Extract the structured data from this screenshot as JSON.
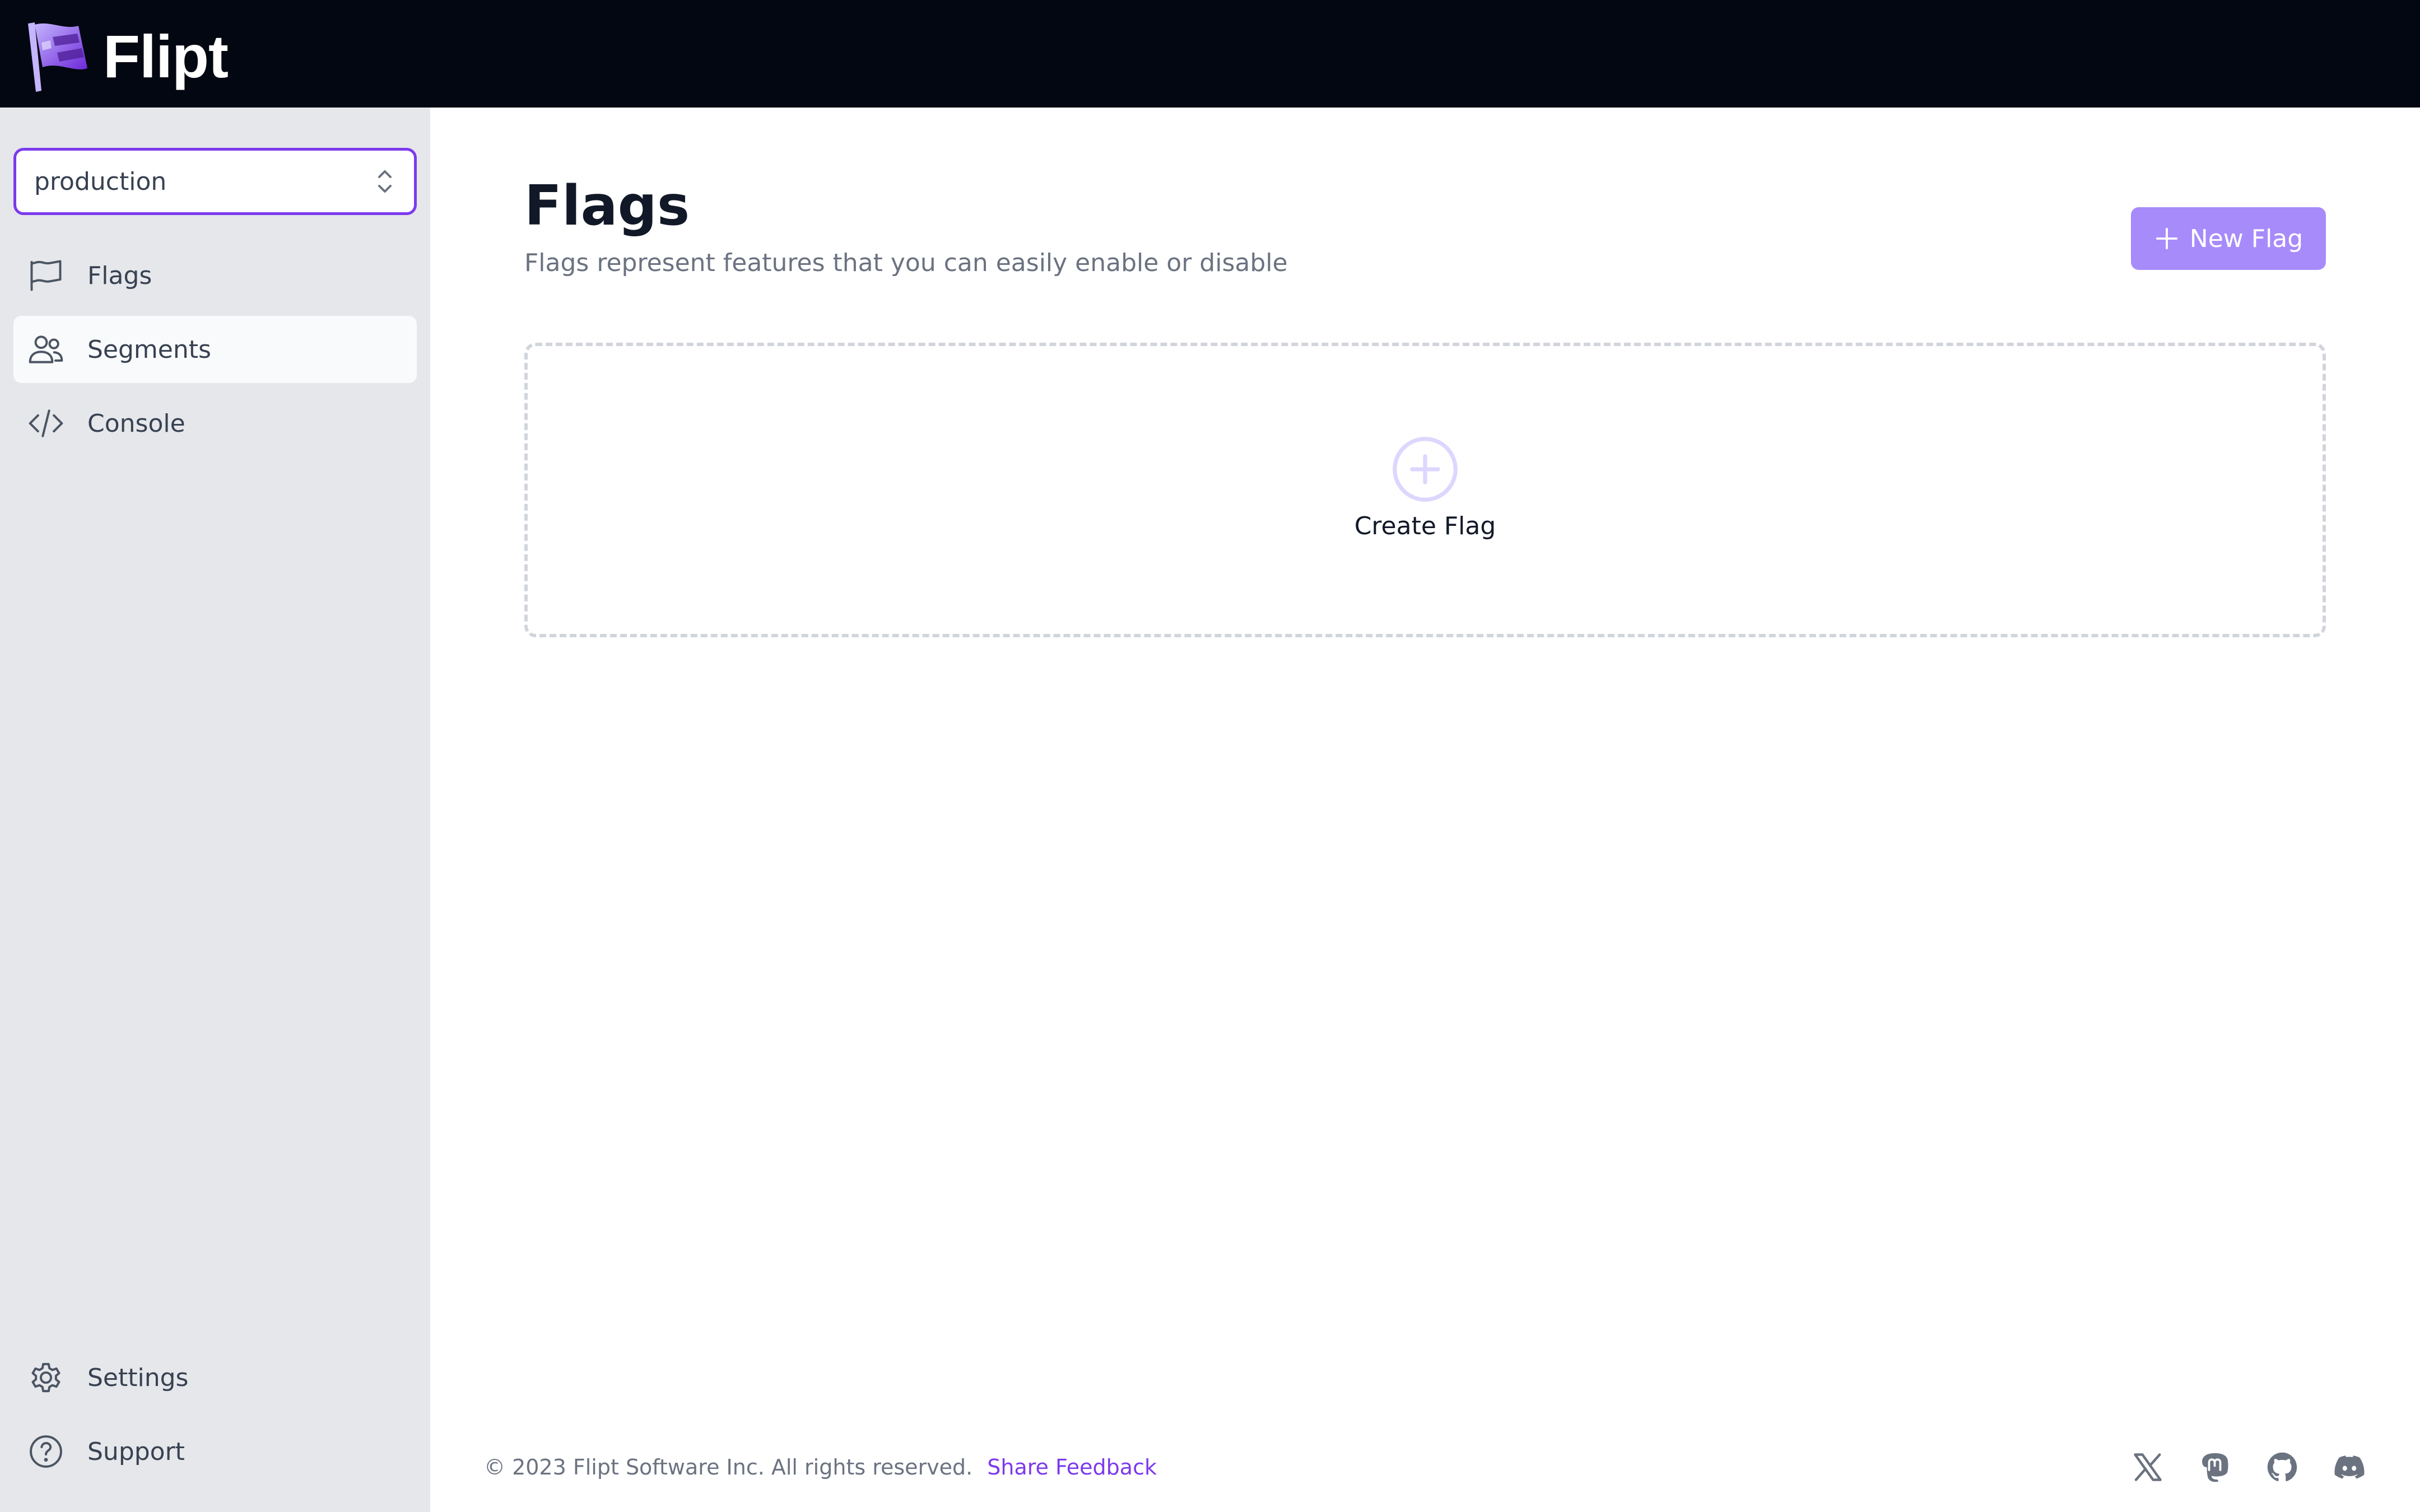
{
  "brand": {
    "name": "Flipt"
  },
  "sidebar": {
    "environment": {
      "selected": "production"
    },
    "items": [
      {
        "label": "Flags",
        "icon": "flag-icon"
      },
      {
        "label": "Segments",
        "icon": "users-icon",
        "active": true
      },
      {
        "label": "Console",
        "icon": "code-icon"
      }
    ],
    "bottom_items": [
      {
        "label": "Settings",
        "icon": "gear-icon"
      },
      {
        "label": "Support",
        "icon": "question-circle-icon"
      }
    ]
  },
  "main": {
    "title": "Flags",
    "subtitle": "Flags represent features that you can easily enable or disable",
    "new_button_label": "New Flag",
    "empty_state_label": "Create Flag"
  },
  "footer": {
    "copyright": "© 2023 Flipt Software Inc. All rights reserved.",
    "feedback_label": "Share Feedback",
    "social_icons": [
      "x-icon",
      "mastodon-icon",
      "github-icon",
      "discord-icon"
    ]
  },
  "colors": {
    "topbar": "#030712",
    "sidebar": "#e5e7eb",
    "accent": "#7c3aed",
    "button": "#a78bfa"
  }
}
